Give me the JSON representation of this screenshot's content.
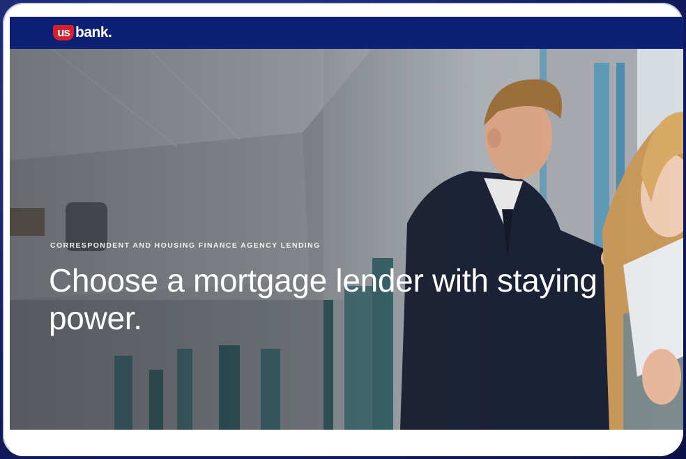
{
  "brand": {
    "logo_mark": "us",
    "logo_word": "bank.",
    "colors": {
      "navy": "#0c2074",
      "red": "#d6202e"
    }
  },
  "hero": {
    "eyebrow": "CORRESPONDENT AND HOUSING FINANCE AGENCY LENDING",
    "headline": "Choose a mortgage lender with staying power."
  }
}
